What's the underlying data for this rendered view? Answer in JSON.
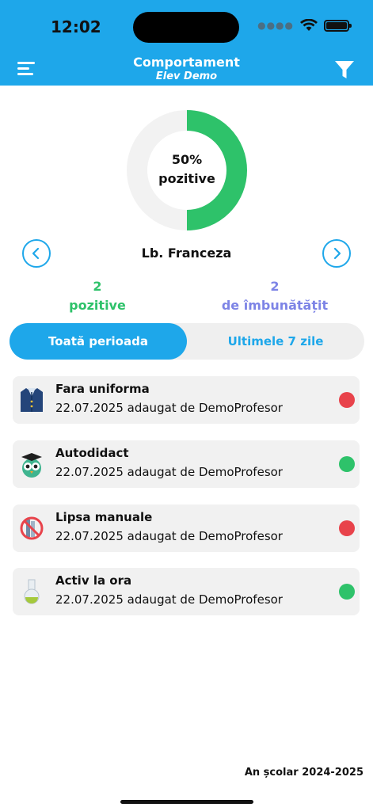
{
  "status_bar": {
    "time": "12:02"
  },
  "header": {
    "title": "Comportament",
    "subtitle": "Elev Demo",
    "background": "#1ea7ea"
  },
  "summary": {
    "percent_label": "50%",
    "percent_caption": "pozitive",
    "positive_fraction": 0.5,
    "subject": "Lb. Franceza",
    "positive_count": "2",
    "positive_label": "pozitive",
    "improve_count": "2",
    "improve_label": "de îmbunătățit"
  },
  "tabs": [
    {
      "label": "Toată perioada",
      "active": true
    },
    {
      "label": "Ultimele 7 zile",
      "active": false
    }
  ],
  "records": [
    {
      "title": "Fara uniforma",
      "subtitle": "22.07.2025 adaugat de DemoProfesor",
      "icon": "uniform-icon",
      "status": "negative",
      "status_color": "#e8434b"
    },
    {
      "title": "Autodidact",
      "subtitle": "22.07.2025 adaugat de DemoProfesor",
      "icon": "owl-graduate-icon",
      "status": "positive",
      "status_color": "#2ec26a"
    },
    {
      "title": "Lipsa manuale",
      "subtitle": "22.07.2025 adaugat de DemoProfesor",
      "icon": "no-books-icon",
      "status": "negative",
      "status_color": "#e8434b"
    },
    {
      "title": "Activ la ora",
      "subtitle": "22.07.2025 adaugat de DemoProfesor",
      "icon": "flask-icon",
      "status": "positive",
      "status_color": "#2ec26a"
    }
  ],
  "footer": {
    "school_year": "An școlar 2024-2025"
  },
  "colors": {
    "accent": "#1ea7ea",
    "positive": "#2ec26a",
    "improve": "#7d84e6",
    "negative": "#e8434b"
  }
}
